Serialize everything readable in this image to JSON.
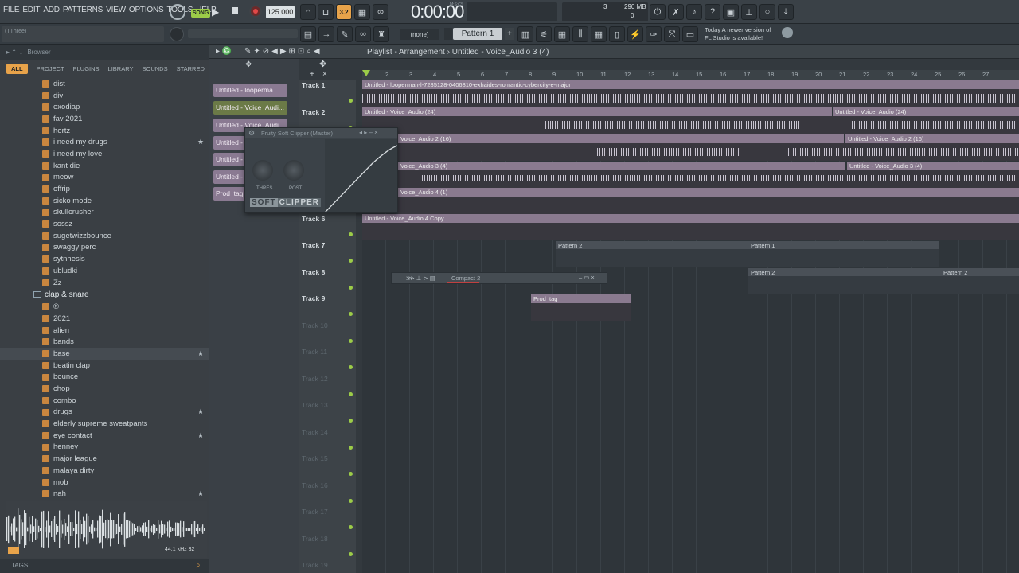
{
  "menu": {
    "items": [
      "FILE",
      "EDIT",
      "ADD",
      "PATTERNS",
      "VIEW",
      "OPTIONS",
      "TOOLS",
      "HELP"
    ]
  },
  "transport": {
    "mode": "SONG",
    "tempo": "125.000",
    "time": "0:00:00",
    "time_label": "M:S:CS",
    "memory": "290 MB",
    "cpu": "3",
    "voices": "0",
    "pattern_label": "Pattern 1",
    "snap_label": "(none)",
    "hint_label": "(TThree)"
  },
  "news": {
    "line1": "Today  A newer version of",
    "line2": "FL Studio is available!"
  },
  "browser": {
    "title": "Browser",
    "tabs": [
      "ALL",
      "PROJECT",
      "PLUGINS",
      "LIBRARY",
      "SOUNDS",
      "STARRED"
    ],
    "items": [
      {
        "label": "dist",
        "star": ""
      },
      {
        "label": "div",
        "star": ""
      },
      {
        "label": "exodiap",
        "star": ""
      },
      {
        "label": "fav 2021",
        "star": ""
      },
      {
        "label": "hertz",
        "star": ""
      },
      {
        "label": "i need my drugs",
        "star": "★"
      },
      {
        "label": "i need my love",
        "star": ""
      },
      {
        "label": "kant die",
        "star": ""
      },
      {
        "label": "meow",
        "star": ""
      },
      {
        "label": "offrip",
        "star": ""
      },
      {
        "label": "sicko mode",
        "star": ""
      },
      {
        "label": "skullcrusher",
        "star": ""
      },
      {
        "label": "sossz",
        "star": ""
      },
      {
        "label": "sugetwizzbounce",
        "star": ""
      },
      {
        "label": "swaggy perc",
        "star": ""
      },
      {
        "label": "sytnhesis",
        "star": ""
      },
      {
        "label": "ubludki",
        "star": ""
      },
      {
        "label": "Zz",
        "star": ""
      }
    ],
    "folder": "clap & snare",
    "items2": [
      {
        "label": "®",
        "star": ""
      },
      {
        "label": "2021",
        "star": ""
      },
      {
        "label": "alien",
        "star": ""
      },
      {
        "label": "bands",
        "star": ""
      },
      {
        "label": "base",
        "star": "★"
      },
      {
        "label": "beatin clap",
        "star": ""
      },
      {
        "label": "bounce",
        "star": ""
      },
      {
        "label": "chop",
        "star": ""
      },
      {
        "label": "combo",
        "star": ""
      },
      {
        "label": "drugs",
        "star": "★"
      },
      {
        "label": "elderly supreme sweatpants",
        "star": ""
      },
      {
        "label": "eye contact",
        "star": "★"
      },
      {
        "label": "henney",
        "star": ""
      },
      {
        "label": "major league",
        "star": ""
      },
      {
        "label": "malaya dirty",
        "star": ""
      },
      {
        "label": "mob",
        "star": ""
      },
      {
        "label": "nah",
        "star": "★"
      }
    ],
    "wave_info": "44.1 kHz 32",
    "tags": "TAGS"
  },
  "playlist": {
    "title": "Playlist - Arrangement",
    "sep": "›",
    "current": "Untitled - Voice_Audio 3 (4)",
    "patterns": [
      "Untitled - looperma...",
      "Untitled - Voice_Audi...",
      "Untitled - Voice_Audi...",
      "Untitled - V",
      "Untitled - V",
      "Untitled - V",
      "Prod_tag"
    ],
    "bars": [
      "2",
      "3",
      "4",
      "5",
      "6",
      "7",
      "8",
      "9",
      "10",
      "11",
      "12",
      "13",
      "14",
      "15",
      "16",
      "17",
      "18",
      "19",
      "20",
      "21",
      "22",
      "23",
      "24",
      "25",
      "26",
      "27"
    ],
    "tracks": [
      "Track 1",
      "Track 2",
      "Track 3",
      "Track 4",
      "Track 5",
      "Track 6",
      "Track 7",
      "Track 8",
      "Track 9",
      "Track 10",
      "Track 11",
      "Track 12",
      "Track 13",
      "Track 14",
      "Track 15",
      "Track 16",
      "Track 17",
      "Track 18",
      "Track 19"
    ],
    "clips": {
      "t1": "Untitled - looperman-l-7285128-0406810-exhaides-romantic-cybercity-e-major",
      "t2a": "Untitled - Voice_Audio (24)",
      "t2b": "Untitled - Voice_Audio (24)",
      "t3a": "Voice_Audio 2 (16)",
      "t3b": "Untitled - Voice_Audio 2 (16)",
      "t4a": "Voice_Audio 3 (4)",
      "t4b": "Untitled - Voice_Audio 3 (4)",
      "t5": "Voice_Audio 4 (1)",
      "t6": "Untitled - Voice_Audio 4 Copy",
      "t7a": "Pattern 2",
      "t7b": "Pattern 1",
      "t8a": "Pattern 2",
      "t8b": "Pattern 2",
      "t9": "Prod_tag"
    }
  },
  "plugin": {
    "title": "Fruity Soft Clipper",
    "target": "(Master)",
    "knob1": "THRES",
    "knob2": "POST",
    "brand1": "SOFT",
    "brand2": "CLIPPER"
  },
  "compact": {
    "title": "Compact 2"
  },
  "colors": {
    "accent": "#e8a34a",
    "clip": "#8a7a8f",
    "led": "#9ccc48"
  }
}
